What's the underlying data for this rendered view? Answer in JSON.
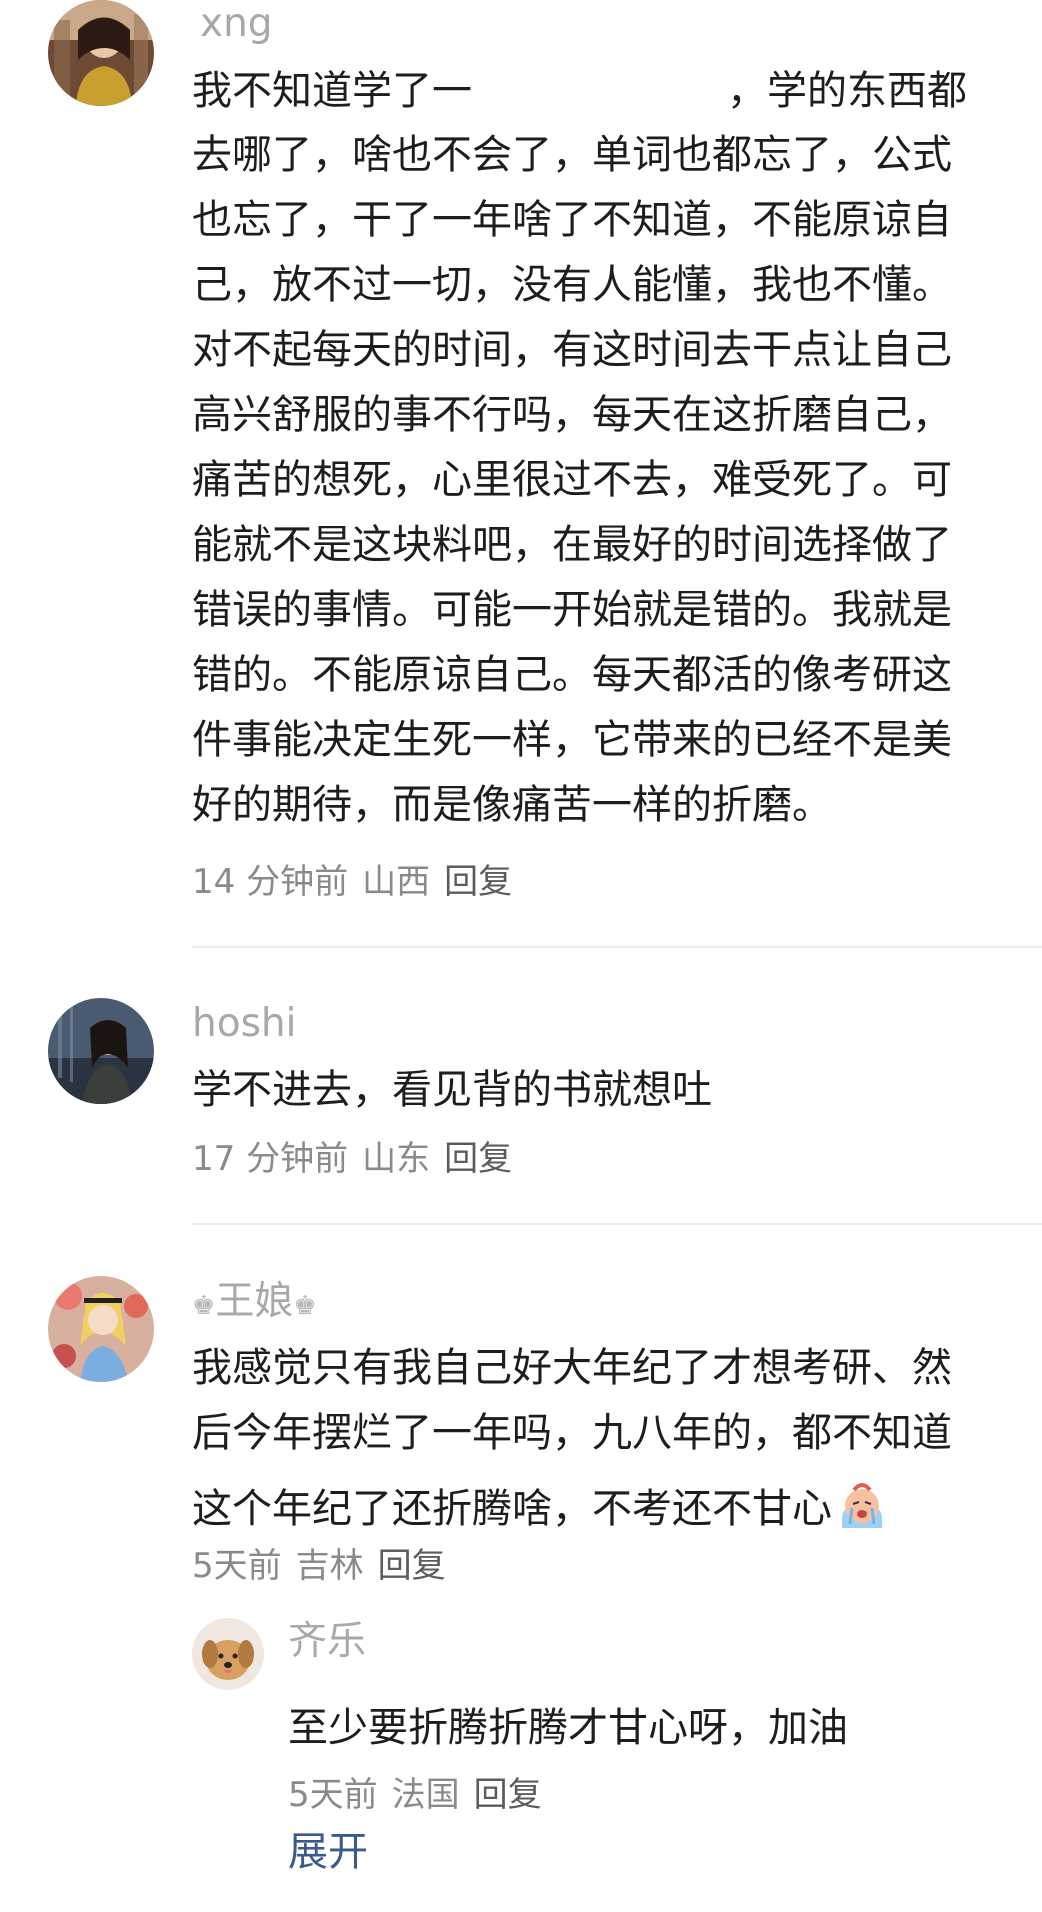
{
  "comments": [
    {
      "username": "xng",
      "lines": [
        [
          "我不知道学了一",
          "，学的东西都"
        ],
        "去哪了，啥也不会了，单词也都忘了，公式",
        "也忘了，干了一年啥了不知道，不能原谅自",
        "己，放不过一切，没有人能懂，我也不懂。",
        "对不起每天的时间，有这时间去干点让自己",
        "高兴舒服的事不行吗，每天在这折磨自己，",
        "痛苦的想死，心里很过不去，难受死了。可",
        "能就不是这块料吧，在最好的时间选择做了",
        "错误的事情。可能一开始就是错的。我就是",
        "错的。不能原谅自己。每天都活的像考研这",
        "件事能决定生死一样，它带来的已经不是美",
        "好的期待，而是像痛苦一样的折磨。"
      ],
      "time": "14 分钟前",
      "location": "山西",
      "reply": "回复"
    },
    {
      "username": "hoshi",
      "lines": [
        "学不进去，看见背的书就想吐"
      ],
      "time": "17 分钟前",
      "location": "山东",
      "reply": "回复"
    },
    {
      "username": "王娘",
      "username_decoration": "♚",
      "lines": [
        "我感觉只有我自己好大年纪了才想考研、然",
        "后今年摆烂了一年吗，九八年的，都不知道",
        "这个年纪了还折腾啥，不考还不甘心"
      ],
      "emoji": "crying-face-icon",
      "time": "5天前",
      "location": "吉林",
      "reply": "回复",
      "sub_reply": {
        "username": "齐乐",
        "lines": [
          "至少要折腾折腾才甘心呀，加油"
        ],
        "time": "5天前",
        "location": "法国",
        "reply": "回复"
      }
    }
  ],
  "expand_label": "展开",
  "colors": {
    "username": "#a8a8a8",
    "text": "#1d1d1d",
    "meta": "#8a8a8a",
    "link": "#3a5a8c",
    "divider": "#eeeeee"
  }
}
